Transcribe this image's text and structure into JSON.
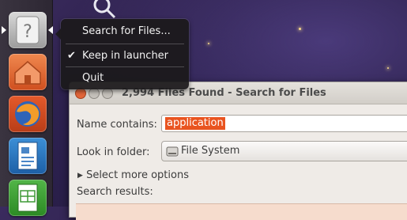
{
  "launcher": {
    "items": [
      {
        "name": "help-app",
        "icon": "question-mark-icon",
        "active": true
      },
      {
        "name": "home-folder",
        "icon": "home-folder-icon"
      },
      {
        "name": "firefox",
        "icon": "firefox-icon"
      },
      {
        "name": "writer",
        "icon": "document-icon"
      },
      {
        "name": "calc",
        "icon": "spreadsheet-icon"
      }
    ],
    "help_glyph": "?"
  },
  "quicklist": {
    "items": [
      {
        "label": "Search for Files..."
      },
      {
        "label": "Keep in launcher",
        "checked": true
      },
      {
        "label": "Quit"
      }
    ],
    "check_glyph": "✔"
  },
  "window": {
    "title": "2,994 Files Found - Search for Files",
    "name_contains_label": "Name contains:",
    "name_contains_value": "application",
    "look_in_label": "Look in folder:",
    "look_in_value": "File System",
    "more_options_label": "Select more options",
    "expander_glyph": "▶",
    "results_label": "Search results:",
    "button_colors": {
      "close": "#e2663a",
      "minimize": "#c5c1bb",
      "maximize": "#c5c1bb"
    }
  },
  "colors": {
    "accent": "#e95420"
  }
}
